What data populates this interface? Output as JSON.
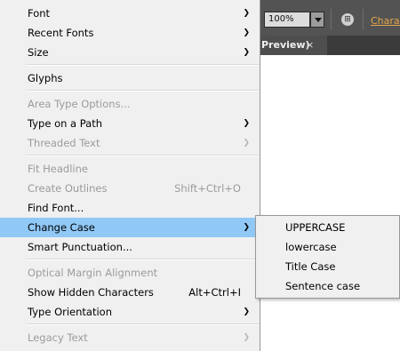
{
  "toolbar": {
    "zoom_value": "100%",
    "grid_icon": "⊞",
    "character_link": "Charac"
  },
  "tab": {
    "title": "Preview)",
    "close_glyph": "×"
  },
  "menu": {
    "items": [
      {
        "label": "Font",
        "submenu": true,
        "enabled": true
      },
      {
        "label": "Recent Fonts",
        "submenu": true,
        "enabled": true
      },
      {
        "label": "Size",
        "submenu": true,
        "enabled": true
      },
      {
        "label": "Glyphs",
        "enabled": true
      },
      {
        "label": "Area Type Options...",
        "enabled": false
      },
      {
        "label": "Type on a Path",
        "submenu": true,
        "enabled": true
      },
      {
        "label": "Threaded Text",
        "submenu": true,
        "enabled": false
      },
      {
        "label": "Fit Headline",
        "enabled": false
      },
      {
        "label": "Create Outlines",
        "shortcut": "Shift+Ctrl+O",
        "enabled": false
      },
      {
        "label": "Find Font...",
        "enabled": true
      },
      {
        "label": "Change Case",
        "submenu": true,
        "enabled": true,
        "highlighted": true
      },
      {
        "label": "Smart Punctuation...",
        "enabled": true
      },
      {
        "label": "Optical Margin Alignment",
        "enabled": false
      },
      {
        "label": "Show Hidden Characters",
        "shortcut": "Alt+Ctrl+I",
        "enabled": true
      },
      {
        "label": "Type Orientation",
        "submenu": true,
        "enabled": true
      },
      {
        "label": "Legacy Text",
        "submenu": true,
        "enabled": false
      }
    ],
    "arrow_glyph": "❯"
  },
  "submenu": {
    "items": [
      "UPPERCASE",
      "lowercase",
      "Title Case",
      "Sentence case"
    ]
  }
}
